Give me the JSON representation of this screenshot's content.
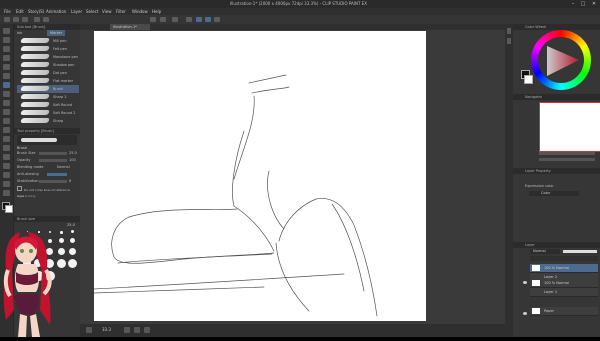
{
  "window": {
    "title": "Illustration-1* (2000 x 4000px 72dpi 33.3%) - CLIP STUDIO PAINT EX",
    "minimize": "–",
    "maximize": "□",
    "close": "✕"
  },
  "menu": [
    "File",
    "Edit",
    "Story(S)",
    "Animation",
    "Layer",
    "Select",
    "View",
    "Filter",
    "Window",
    "Help"
  ],
  "tabs": [
    {
      "label": "Illustration-1*"
    }
  ],
  "subtool": {
    "header": "Sub tool [Brush]",
    "group": "Ink",
    "group_tab": "Marker",
    "brushes": [
      {
        "label": "Mill pen"
      },
      {
        "label": "Felt pen"
      },
      {
        "label": "Monotone pen"
      },
      {
        "label": "Shadow pen"
      },
      {
        "label": "Dot pen"
      },
      {
        "label": "Flat marker"
      },
      {
        "label": "Brush",
        "selected": true
      },
      {
        "label": "Sharp 2"
      },
      {
        "label": "Soft Round"
      },
      {
        "label": "Soft Round 2"
      },
      {
        "label": "Sharp"
      }
    ]
  },
  "tool_property": {
    "header": "Tool property [Brush]",
    "brush_name": "Brush",
    "rows": [
      {
        "label": "Brush Size",
        "value": "25.0"
      },
      {
        "label": "Opacity",
        "value": "100"
      },
      {
        "label": "Blending mode",
        "value": "Normal"
      },
      {
        "label": "Anti-aliasing",
        "value": ""
      },
      {
        "label": "Stabilization",
        "value": "6"
      }
    ],
    "checkbox_label": "Do not cross lines of reference layer",
    "dropdown_label": "Area scaling"
  },
  "brush_size_panel": {
    "header": "Brush size",
    "value": "25.0"
  },
  "color_wheel": {
    "header": "Color Wheel",
    "main_color": "#111111",
    "sub_color": "#ffffff"
  },
  "navigator": {
    "header": "Navigator"
  },
  "layer_property": {
    "header": "Layer Property",
    "label": "Expression color",
    "value": "Color"
  },
  "layers": {
    "header": "Layer",
    "blend": "Normal",
    "opacity": "100",
    "items": [
      {
        "name": "100 % Normal",
        "sub": "Layer 2",
        "selected": true
      },
      {
        "name": "100 % Normal",
        "sub": "Layer 1",
        "selected": false
      },
      {
        "name": "Paper",
        "sub": "",
        "selected": false
      }
    ]
  },
  "status": {
    "zoom": "33.3"
  },
  "colors": {
    "accent": "#4d6a8f",
    "bg": "#3b3b3b"
  }
}
